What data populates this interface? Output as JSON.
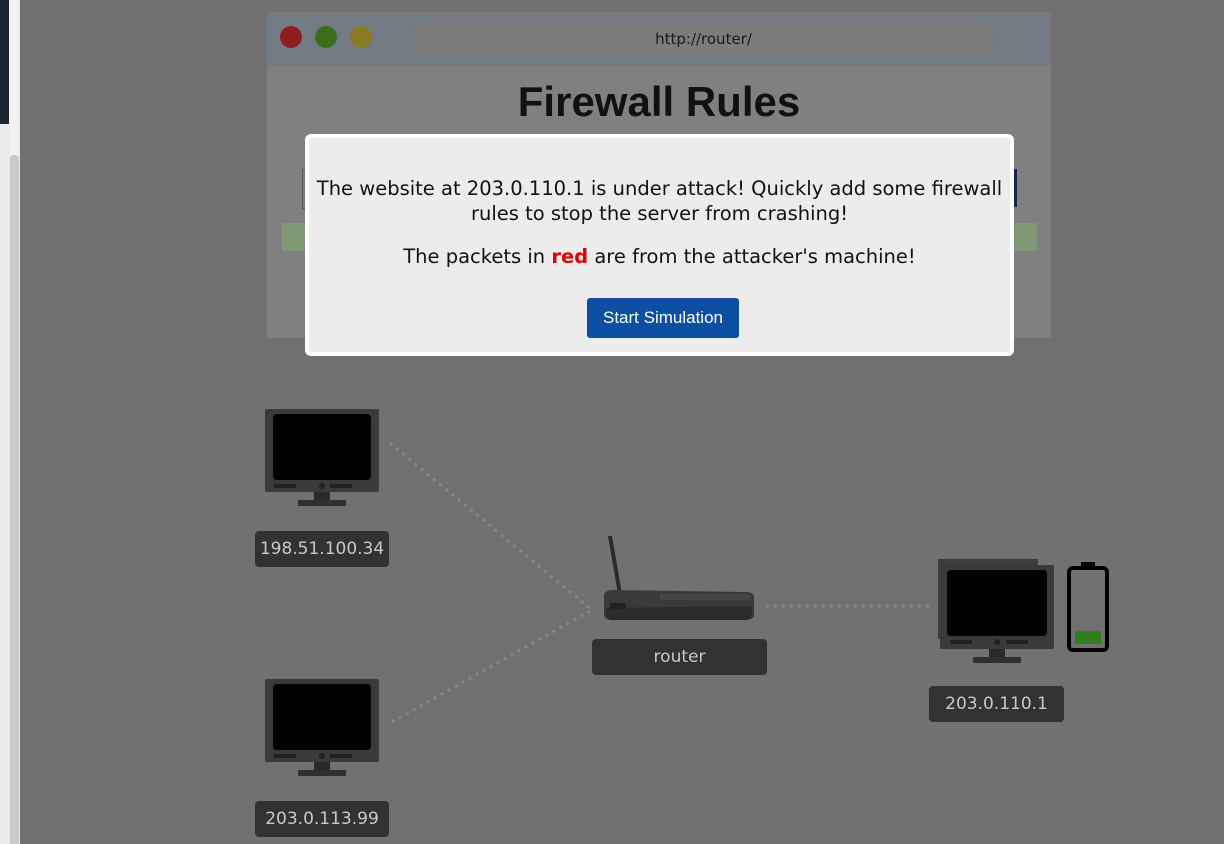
{
  "browser": {
    "url": "http://router/",
    "heading": "Firewall Rules"
  },
  "modal": {
    "line1_part1": "The website at 203.0.110.1 is under attack! Quickly add some firewall",
    "line1_part2": "rules to stop the server from crashing!",
    "line2_before": "The packets in ",
    "line2_highlight": "red",
    "line2_after": " are from the attacker's machine!",
    "highlight_color": "#e00000",
    "start_button_label": "Start Simulation"
  },
  "network": {
    "client_top_ip": "198.51.100.34",
    "client_bottom_ip": "203.0.113.99",
    "router_label": "router",
    "server_ip": "203.0.110.1",
    "server_battery_level": 0.2
  },
  "colors": {
    "accent_button": "#0d4fa3",
    "battery_fill": "#2f7d1f"
  }
}
